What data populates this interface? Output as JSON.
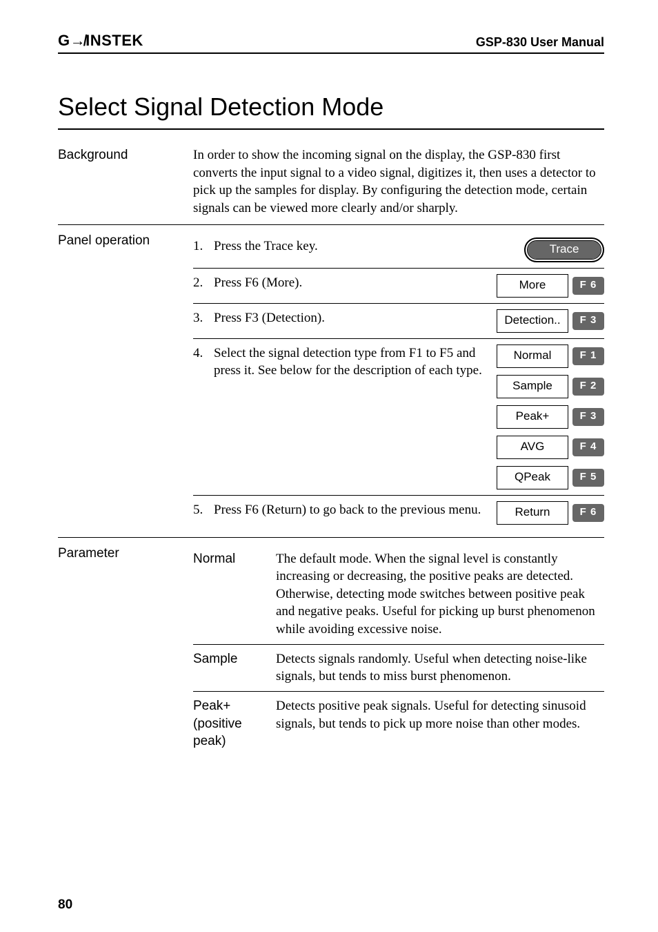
{
  "header": {
    "brand": "G↛INSTEK",
    "manual": "GSP-830 User Manual"
  },
  "title": "Select Signal Detection Mode",
  "background": {
    "label": "Background",
    "text": "In order to show the incoming signal on the display, the GSP-830 first converts the input signal to a video signal, digitizes it, then uses a detector to pick up the samples for display. By configuring the detection mode, certain signals can be viewed more clearly and/or sharply."
  },
  "panel": {
    "label": "Panel operation",
    "steps": [
      {
        "n": "1.",
        "text": "Press the Trace key.",
        "hardkey": "Trace"
      },
      {
        "n": "2.",
        "text": "Press F6 (More).",
        "soft": "More",
        "fk": "F 6"
      },
      {
        "n": "3.",
        "text": "Press F3 (Detection).",
        "soft": "Detection..",
        "fk": "F 3"
      },
      {
        "n": "4.",
        "text": "Select the signal detection type from F1 to F5 and press it. See below for the description of each type.",
        "options": [
          {
            "soft": "Normal",
            "fk": "F 1"
          },
          {
            "soft": "Sample",
            "fk": "F 2"
          },
          {
            "soft": "Peak+",
            "fk": "F 3"
          },
          {
            "soft": "AVG",
            "fk": "F 4"
          },
          {
            "soft": "QPeak",
            "fk": "F 5"
          }
        ]
      },
      {
        "n": "5.",
        "text": "Press F6 (Return) to go back to the previous menu.",
        "soft": "Return",
        "fk": "F 6"
      }
    ]
  },
  "parameter": {
    "label": "Parameter",
    "rows": [
      {
        "name": "Normal",
        "desc": "The default mode. When the signal level is constantly increasing or decreasing, the positive peaks are detected. Otherwise, detecting mode switches between positive peak and negative peaks. Useful for picking up burst phenomenon while avoiding excessive noise."
      },
      {
        "name": "Sample",
        "desc": "Detects signals randomly. Useful when detecting noise-like signals, but tends to miss burst phenomenon."
      },
      {
        "name": "Peak+ (positive peak)",
        "desc": "Detects positive peak signals. Useful for detecting sinusoid signals, but tends to pick up more noise than other modes."
      }
    ]
  },
  "page": "80"
}
